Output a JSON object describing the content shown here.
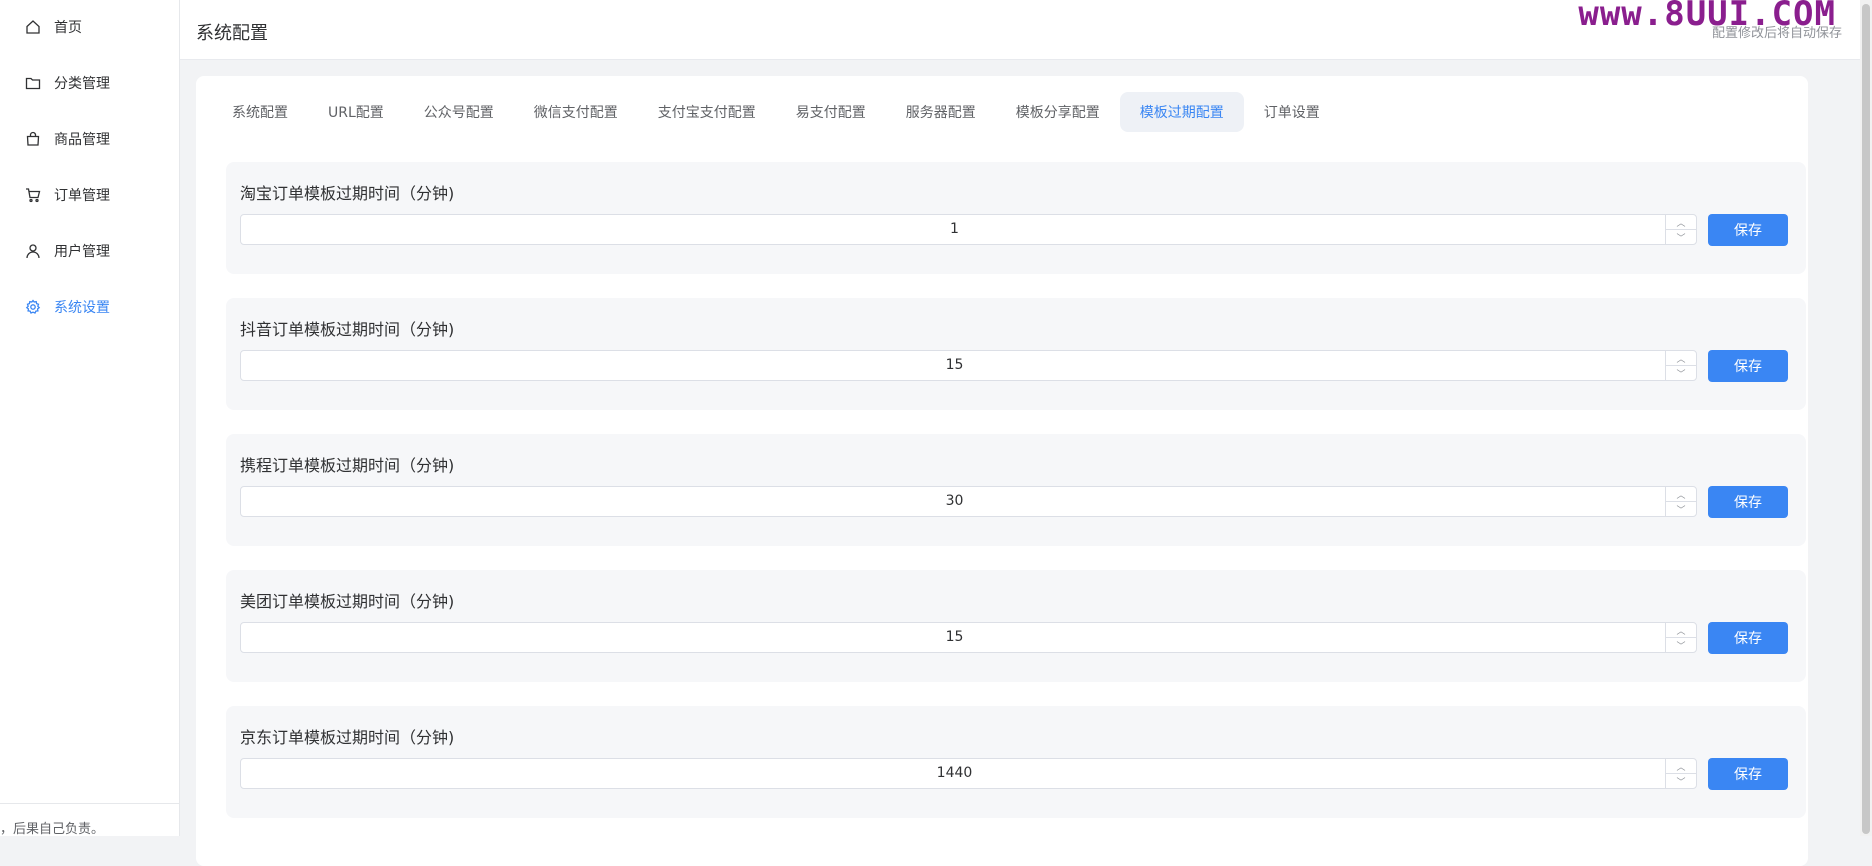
{
  "sidebar": {
    "items": [
      {
        "label": "首页",
        "icon": "home-icon"
      },
      {
        "label": "分类管理",
        "icon": "folder-icon"
      },
      {
        "label": "商品管理",
        "icon": "shopping-bag-icon"
      },
      {
        "label": "订单管理",
        "icon": "cart-icon"
      },
      {
        "label": "用户管理",
        "icon": "user-icon"
      },
      {
        "label": "系统设置",
        "icon": "gear-icon",
        "active": true
      }
    ],
    "footer": "，后果自己负责。"
  },
  "header": {
    "title": "系统配置",
    "note": "配置修改后将自动保存",
    "watermark": "www.8UUI.COM"
  },
  "tabs": [
    {
      "label": "系统配置"
    },
    {
      "label": "URL配置"
    },
    {
      "label": "公众号配置"
    },
    {
      "label": "微信支付配置"
    },
    {
      "label": "支付宝支付配置"
    },
    {
      "label": "易支付配置"
    },
    {
      "label": "服务器配置"
    },
    {
      "label": "模板分享配置"
    },
    {
      "label": "模板过期配置",
      "active": true
    },
    {
      "label": "订单设置"
    }
  ],
  "sections": [
    {
      "label": "淘宝订单模板过期时间（分钟)",
      "value": "1",
      "button": "保存"
    },
    {
      "label": "抖音订单模板过期时间（分钟)",
      "value": "15",
      "button": "保存"
    },
    {
      "label": "携程订单模板过期时间（分钟)",
      "value": "30",
      "button": "保存"
    },
    {
      "label": "美团订单模板过期时间（分钟)",
      "value": "15",
      "button": "保存"
    },
    {
      "label": "京东订单模板过期时间（分钟)",
      "value": "1440",
      "button": "保存"
    }
  ],
  "colors": {
    "accent": "#3a86f3",
    "watermark": "#8a1e8e"
  }
}
